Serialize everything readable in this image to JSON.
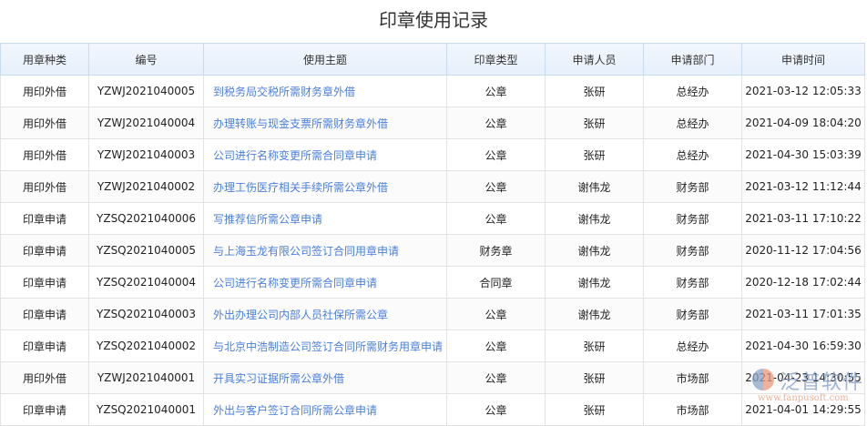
{
  "title": "印章使用记录",
  "columns": [
    "用章种类",
    "编号",
    "使用主题",
    "印章类型",
    "申请人员",
    "申请部门",
    "申请时间"
  ],
  "rows": [
    [
      "用印外借",
      "YZWJ2021040005",
      "到税务局交税所需财务章外借",
      "公章",
      "张研",
      "总经办",
      "2021-03-12 12:05:33"
    ],
    [
      "用印外借",
      "YZWJ2021040004",
      "办理转账与现金支票所需财务章外借",
      "公章",
      "张研",
      "总经办",
      "2021-04-09 18:04:20"
    ],
    [
      "用印外借",
      "YZWJ2021040003",
      "公司进行名称变更所需合同章申请",
      "公章",
      "张研",
      "总经办",
      "2021-04-30 15:03:39"
    ],
    [
      "用印外借",
      "YZWJ2021040002",
      "办理工伤医疗相关手续所需公章外借",
      "公章",
      "谢伟龙",
      "财务部",
      "2021-03-12 11:12:44"
    ],
    [
      "印章申请",
      "YZSQ2021040006",
      "写推荐信所需公章申请",
      "公章",
      "谢伟龙",
      "财务部",
      "2021-03-11 17:10:22"
    ],
    [
      "印章申请",
      "YZSQ2021040005",
      "与上海玉龙有限公司签订合同用章申请",
      "财务章",
      "谢伟龙",
      "财务部",
      "2020-11-12 17:04:56"
    ],
    [
      "印章申请",
      "YZSQ2021040004",
      "公司进行名称变更所需合同章申请",
      "合同章",
      "谢伟龙",
      "财务部",
      "2020-12-18 17:02:44"
    ],
    [
      "印章申请",
      "YZSQ2021040003",
      "外出办理公司内部人员社保所需公章",
      "公章",
      "谢伟龙",
      "财务部",
      "2021-03-11 17:01:35"
    ],
    [
      "印章申请",
      "YZSQ2021040002",
      "与北京中浩制造公司签订合同所需财务用章申请",
      "公章",
      "张研",
      "总经办",
      "2021-04-30 16:59:30"
    ],
    [
      "用印外借",
      "YZWJ2021040001",
      "开具实习证据所需公章外借",
      "公章",
      "张研",
      "市场部",
      "2021-04-23 14:30:55"
    ],
    [
      "印章申请",
      "YZSQ2021040001",
      "外出与客户签订合同所需公章申请",
      "公章",
      "张研",
      "市场部",
      "2021-04-01 14:29:55"
    ]
  ],
  "watermark": {
    "name": "泛普软件",
    "url": "www.fanpusoft.com"
  },
  "colors": {
    "link": "#4a7fdc",
    "header_bg": "#e9f1fc"
  }
}
